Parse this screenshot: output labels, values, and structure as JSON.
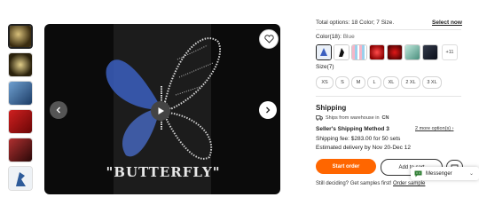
{
  "options": {
    "total_text": "Total options: 18 Color; 7 Size.",
    "select_now": "Select now"
  },
  "color": {
    "label": "Color(18):",
    "value": "Blue",
    "more": "+11",
    "swatches": [
      "blue-butterfly",
      "black-shape",
      "stripe",
      "red-rhinestone",
      "red-heart",
      "mint",
      "dark-pattern"
    ]
  },
  "size": {
    "label": "Size(7)",
    "items": [
      "XS",
      "S",
      "M",
      "L",
      "XL",
      "2 XL",
      "3 XL"
    ]
  },
  "shipping": {
    "title": "Shipping",
    "from": "Ships from warehouse in",
    "from_country": "CN",
    "method": "Seller's Shipping Method 3",
    "more_options": "2 more option(s)",
    "fee": "Shipping fee: $283.00 for 50 sets",
    "estimated": "Estimated delivery by Nov 20-Dec 12"
  },
  "actions": {
    "start_order": "Start order",
    "add_to_cart": "Add to cart"
  },
  "samples": {
    "question": "Still deciding? Get samples first!",
    "link": "Order sample"
  },
  "messenger": {
    "label": "Messenger"
  },
  "viewer": {
    "text": "\"BUTTERFLY\""
  },
  "colors": {
    "accent": "#ff6600",
    "viewer_bg": "#0b0b0b"
  }
}
